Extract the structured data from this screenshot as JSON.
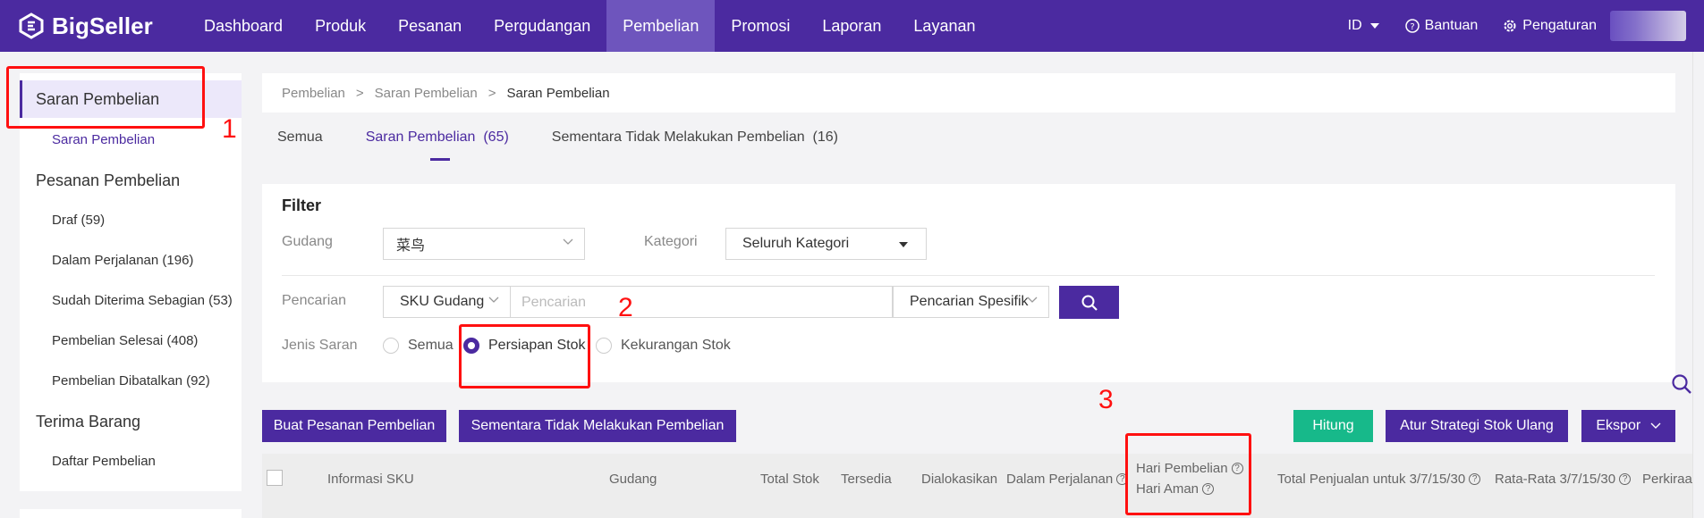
{
  "brand": {
    "name": "BigSeller"
  },
  "nav": {
    "items": [
      {
        "label": "Dashboard",
        "active": false
      },
      {
        "label": "Produk",
        "active": false
      },
      {
        "label": "Pesanan",
        "active": false
      },
      {
        "label": "Pergudangan",
        "active": false
      },
      {
        "label": "Pembelian",
        "active": true
      },
      {
        "label": "Promosi",
        "active": false
      },
      {
        "label": "Laporan",
        "active": false
      },
      {
        "label": "Layanan",
        "active": false
      }
    ],
    "language": "ID",
    "help": "Bantuan",
    "settings": "Pengaturan"
  },
  "sidebar": {
    "group1": "Saran Pembelian",
    "group1_items": [
      "Saran Pembelian"
    ],
    "group2": "Pesanan Pembelian",
    "group2_items": [
      "Draf (59)",
      "Dalam Perjalanan (196)",
      "Sudah Diterima Sebagian (53)",
      "Pembelian Selesai (408)",
      "Pembelian Dibatalkan (92)"
    ],
    "group3": "Terima Barang",
    "group3_items": [
      "Daftar Pembelian"
    ]
  },
  "breadcrumb": [
    "Pembelian",
    "Saran Pembelian",
    "Saran Pembelian"
  ],
  "tabs": [
    {
      "label": "Semua",
      "active": false
    },
    {
      "label": "Saran Pembelian  (65)",
      "active": true
    },
    {
      "label": "Sementara Tidak Melakukan Pembelian  (16)",
      "active": false
    }
  ],
  "filter": {
    "title": "Filter",
    "warehouse_label": "Gudang",
    "warehouse_value": "菜鸟",
    "category_label": "Kategori",
    "category_value": "Seluruh Kategori",
    "search_label": "Pencarian",
    "search_type": "SKU Gudang",
    "search_placeholder": "Pencarian",
    "search_mode": "Pencarian Spesifik",
    "suggestion_label": "Jenis Saran",
    "suggestion_options": [
      {
        "label": "Semua",
        "selected": false
      },
      {
        "label": "Persiapan Stok",
        "selected": true
      },
      {
        "label": "Kekurangan Stok",
        "selected": false
      }
    ]
  },
  "actions": {
    "create_po": "Buat Pesanan Pembelian",
    "skip_purchase": "Sementara Tidak Melakukan Pembelian",
    "calculate": "Hitung",
    "reset_strategy": "Atur Strategi Stok Ulang",
    "export": "Ekspor"
  },
  "table": {
    "columns": [
      "Informasi SKU",
      "Gudang",
      "Total Stok",
      "Tersedia",
      "Dialokasikan",
      "Dalam Perjalanan",
      "Hari Pembelian",
      "Hari Aman",
      "Total Penjualan untuk 3/7/15/30",
      "Rata-Rata 3/7/15/30",
      "Perkiraan"
    ]
  },
  "annotations": [
    "1",
    "2",
    "3"
  ],
  "colors": {
    "brand": "#4b2aa0",
    "nav_active": "#6e55bd",
    "green": "#17b98a",
    "annotation": "#ff1010"
  }
}
